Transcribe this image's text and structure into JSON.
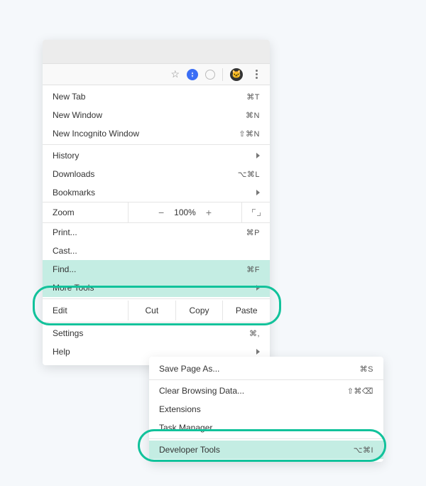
{
  "iconbar": {
    "star_name": "bookmark-star-icon",
    "nav_name": "navigation-icon",
    "gauge_name": "speed-icon",
    "profile_name": "profile-avatar-icon",
    "kebab_name": "more-vertical-icon"
  },
  "menu": {
    "newTab": {
      "label": "New Tab",
      "shortcut": "⌘T"
    },
    "newWindow": {
      "label": "New Window",
      "shortcut": "⌘N"
    },
    "newIncognito": {
      "label": "New Incognito Window",
      "shortcut": "⇧⌘N"
    },
    "history": {
      "label": "History"
    },
    "downloads": {
      "label": "Downloads",
      "shortcut": "⌥⌘L"
    },
    "bookmarks": {
      "label": "Bookmarks"
    },
    "zoom": {
      "label": "Zoom",
      "value": "100%"
    },
    "print": {
      "label": "Print...",
      "shortcut": "⌘P"
    },
    "cast": {
      "label": "Cast..."
    },
    "find": {
      "label": "Find...",
      "shortcut": "⌘F"
    },
    "moreTools": {
      "label": "More Tools"
    },
    "edit": {
      "label": "Edit",
      "cut": "Cut",
      "copy": "Copy",
      "paste": "Paste"
    },
    "settings": {
      "label": "Settings",
      "shortcut": "⌘,"
    },
    "help": {
      "label": "Help"
    }
  },
  "submenu": {
    "savePageAs": {
      "label": "Save Page As...",
      "shortcut": "⌘S"
    },
    "clearBrowsingData": {
      "label": "Clear Browsing Data...",
      "shortcut": "⇧⌘⌫"
    },
    "extensions": {
      "label": "Extensions"
    },
    "taskManager": {
      "label": "Task Manager"
    },
    "devTools": {
      "label": "Developer Tools",
      "shortcut": "⌥⌘I"
    }
  }
}
